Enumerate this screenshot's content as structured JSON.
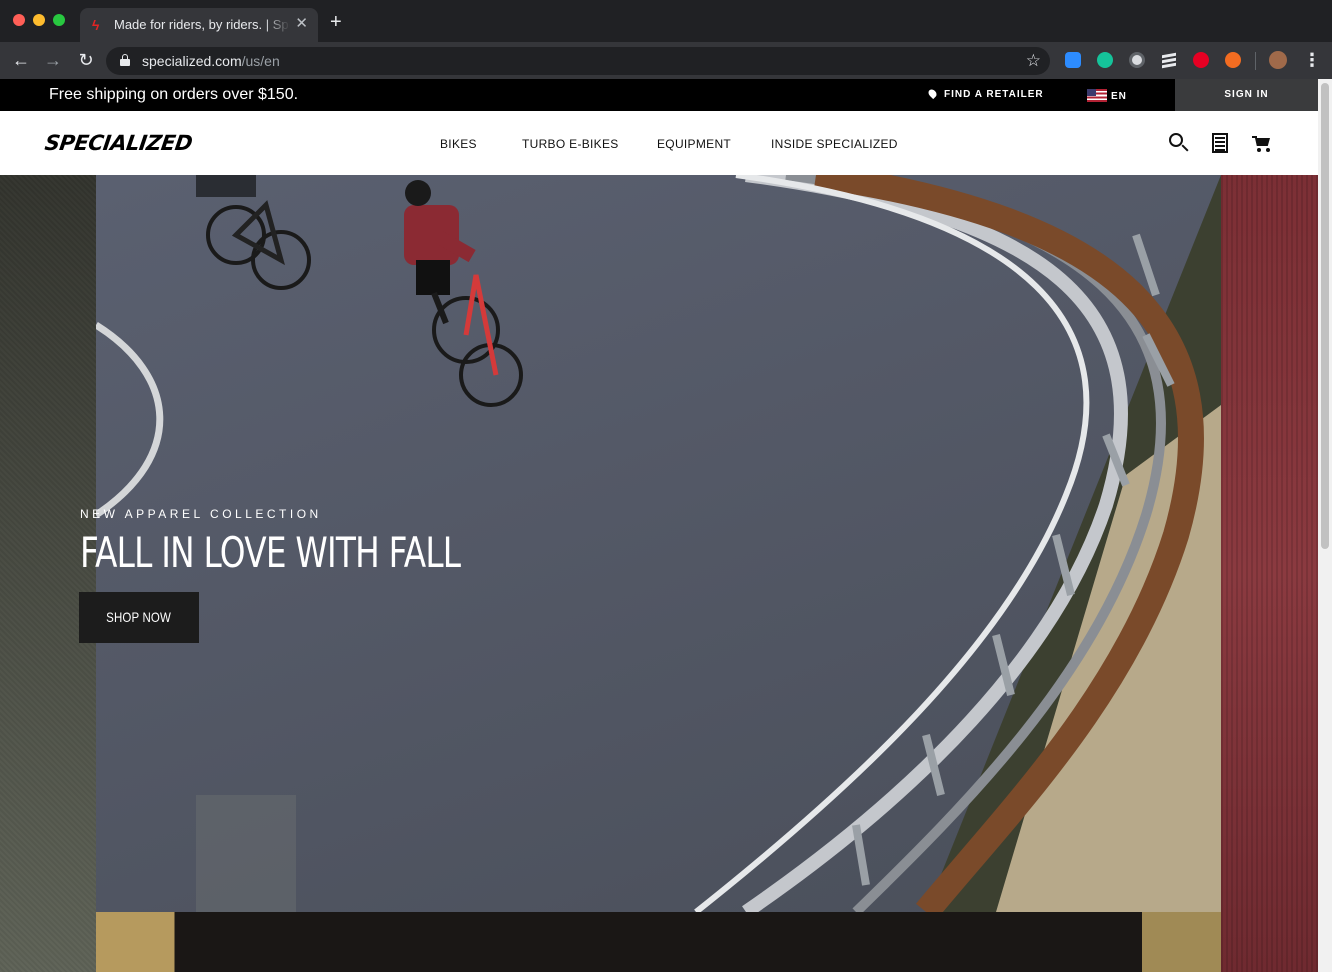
{
  "browser": {
    "tab_title": "Made for riders, by riders. | Specialized.com",
    "tab_favicon": "specialized-s-icon",
    "url_host": "specialized.com",
    "url_path": "/us/en",
    "icons": [
      "back-arrow-icon",
      "forward-arrow-icon",
      "reload-icon",
      "lock-icon",
      "star-icon",
      "zoom-extension-icon",
      "grammarly-extension-icon",
      "circle-extension-icon",
      "buffer-extension-icon",
      "pinterest-extension-icon",
      "honey-extension-icon",
      "profile-avatar",
      "chrome-menu-icon"
    ]
  },
  "utility": {
    "shipping": "Free shipping on orders over $150.",
    "retailer": "FIND A RETAILER",
    "language": "EN",
    "signin": "SIGN IN"
  },
  "nav": {
    "logo": "SPECIALIZED",
    "links": [
      "BIKES",
      "TURBO E-BIKES",
      "EQUIPMENT",
      "INSIDE SPECIALIZED"
    ]
  },
  "hero": {
    "eyebrow": "NEW APPAREL COLLECTION",
    "title": "FALL IN LOVE WITH FALL",
    "cta": "SHOP NOW"
  },
  "colors": {
    "utility_bar": "#000000",
    "signin_bg": "#3a3b3d",
    "cta_bg": "#1c1c1c",
    "jersey_red": "#8b2a33"
  }
}
